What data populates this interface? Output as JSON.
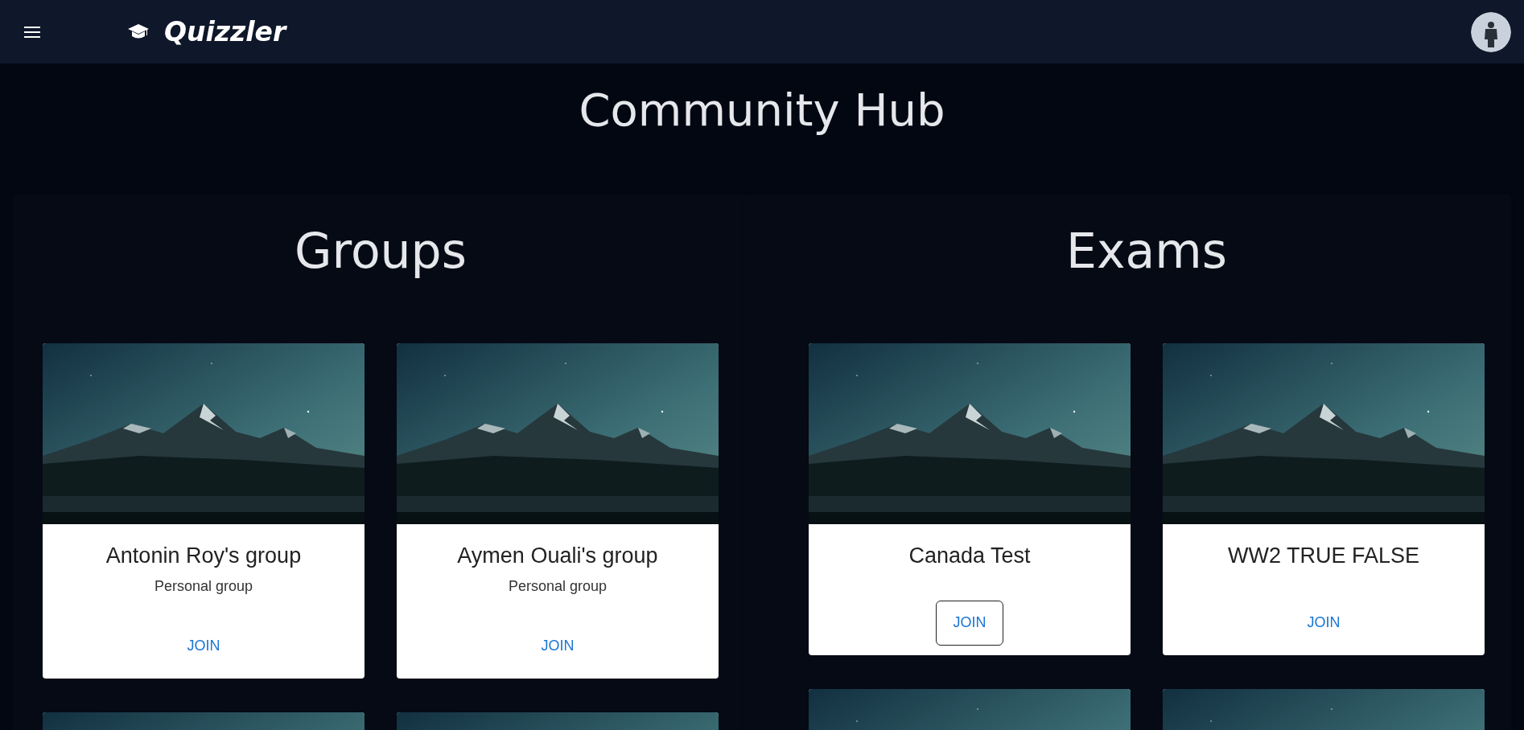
{
  "header": {
    "brand": "Quizzler"
  },
  "title": "Community Hub",
  "sections": [
    {
      "heading": "Groups",
      "cards": [
        {
          "kind": "card",
          "title": "Antonin Roy's group",
          "subtitle": "Personal group",
          "action": {
            "label": "JOIN",
            "focused": false
          }
        },
        {
          "kind": "card",
          "title": "Aymen Ouali's group",
          "subtitle": "Personal group",
          "action": {
            "label": "JOIN",
            "focused": false
          }
        },
        {
          "kind": "picture"
        },
        {
          "kind": "picture"
        }
      ]
    },
    {
      "heading": "Exams",
      "cards": [
        {
          "kind": "card",
          "title": "Canada Test",
          "action": {
            "label": "JOIN",
            "focused": true
          }
        },
        {
          "kind": "card",
          "title": "WW2 TRUE FALSE",
          "action": {
            "label": "JOIN",
            "focused": false
          }
        },
        {
          "kind": "picture"
        },
        {
          "kind": "picture"
        }
      ]
    }
  ]
}
